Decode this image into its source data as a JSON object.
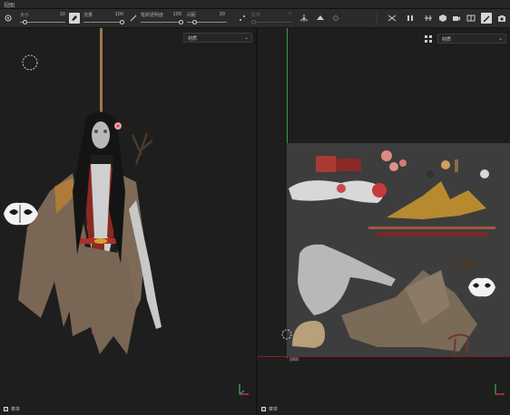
{
  "window": {
    "title": "视图"
  },
  "toolbar": {
    "size_label": "大小",
    "size_value": "10",
    "size_level": 0.1,
    "flow_label": "流量",
    "flow_value": "100",
    "flow_level": 1.0,
    "opacity_label": "笔刷透明度",
    "opacity_value": "100",
    "opacity_level": 1.0,
    "spacing_label": "间距",
    "spacing_value": "20",
    "spacing_level": 0.2,
    "dim_label": "距离",
    "dim_value": "5",
    "dim_level": 0.05
  },
  "left_viewport": {
    "channel_dropdown": "材质",
    "footer_label": "菜单"
  },
  "right_viewport": {
    "channel_dropdown": "材质",
    "footer_label": "菜单",
    "uv_label": "1001"
  },
  "colors": {
    "panel_bg": "#1e1e1e",
    "toolbar_bg": "#2b2b2b",
    "uv_bg": "#3d3d3d",
    "uv_axis_green": "#3aa03a",
    "uv_axis_red": "#8a1f1f"
  },
  "icons": {
    "toolbar_left": [
      "brush-settings-icon"
    ],
    "toolbar_right": [
      "symmetry-icon",
      "pause-icon",
      "split-view-icon",
      "display-icon",
      "camera-video-icon",
      "layout-icon",
      "brush-icon",
      "screenshot-icon"
    ]
  }
}
